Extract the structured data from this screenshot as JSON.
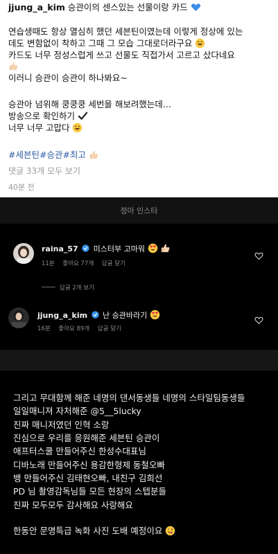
{
  "post": {
    "username": "jjung_a_kim",
    "title": " 승관이의 센스있는 선물이랑 카드",
    "lines": [
      "연습생때도 항상 열심히 했던 세븐틴이였는데 이렇게 정상에 있는",
      "데도 변함없이 착하고 그때 그 모습 그대로더라구요",
      "카드도 너무 정성스럽게 쓰고 선물도 직접가서 고르고 샀다네요",
      "이러니 승관이 승관이 하나봐요~",
      "승관아 넘위해 쿵쿵쿵 세번을 해보려했는데...",
      "방송으로 확인하기",
      "너무 너무 고맙다"
    ],
    "tags": "#세븐틴#승관#최고",
    "view_comments": "댓글 33개 모두 보기",
    "time_ago": "40분 전"
  },
  "band": {
    "title": "정아 인스타"
  },
  "comments": [
    {
      "username": "raina_57",
      "text": " 미스터부 고마워",
      "time": "11분",
      "likes": "좋아요 77개",
      "reply": "답글 달기"
    },
    {
      "username": "jjung_a_kim",
      "text": " 난 승관바라기",
      "time": "16분",
      "likes": "좋아요 89개",
      "reply": "답글 달기"
    }
  ],
  "view_replies": "답글 2개 보기",
  "thanks": {
    "lines": [
      "그리고 무대함께 해준 네명의 댄서동생들 네명의 스타일팀동생들",
      "일일매니져 자처해준 @5__5lucky",
      "진짜 매니저였던 인혁 소랑",
      "진심으로 우리를 응원해준 세븐틴 승관이",
      "애프터스쿨 만들어주신 한성수대표님",
      "디바노래 만들어주신 용감한형제 동철오빠",
      "뱅 만들어주신 김태현오빠, 내친구 김희선",
      "PD 님 촬영감독님들 모든 현장의 스텝분들",
      "진짜 모두모두 감사해요 사랑해요",
      "한동안 문명특급 녹화 사진 도배 예정이요"
    ]
  },
  "colors": {
    "hashtag": "#2f5ea6",
    "verified": "#3897f0",
    "heart_blue": "#3d8de6"
  },
  "icons": {
    "heart_emoji": "blue-heart-icon",
    "smile_emoji": "grin-icon",
    "thumbs_emoji": "thumbs-up-icon",
    "check_emoji": "check-mark-icon",
    "verified": "verified-badge-icon",
    "like": "heart-outline-icon"
  }
}
